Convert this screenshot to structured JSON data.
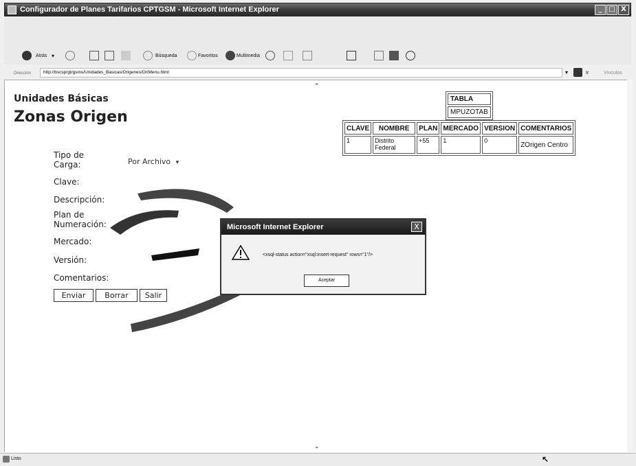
{
  "window": {
    "title": "Configurador de Planes Tarifarios CPTGSM - Microsoft Internet Explorer",
    "min": "_",
    "max": "□",
    "close": "X"
  },
  "toolbar": {
    "back": "Atrás",
    "search": "Búsqueda",
    "favorites": "Favoritos",
    "multimedia": "Multimedia",
    "go": "Ir"
  },
  "address": {
    "label": "Dirección",
    "url": "http://bscsprgt/gsms/Unidades_Basicas/Origenes/OriMenu.html",
    "links": "Vínculos"
  },
  "page": {
    "heading_small": "Unidades Básicas",
    "heading_large": "Zonas Origen"
  },
  "form": {
    "tipo_label": "Tipo de Carga:",
    "tipo_value": "Por Archivo",
    "clave_label": "Clave:",
    "descripcion_label": "Descripción:",
    "plan_label": "Plan de Numeración:",
    "mercado_label": "Mercado:",
    "version_label": "Versión:",
    "comentarios_label": "Comentarios:",
    "enviar": "Enviar",
    "borrar": "Borrar",
    "salir": "Salir"
  },
  "table_info": {
    "header": "TABLA",
    "name": "MPUZOTAB"
  },
  "data_table": {
    "columns": [
      "CLAVE",
      "NOMBRE",
      "PLAN",
      "MERCADO",
      "VERSION",
      "COMENTARIOS"
    ],
    "rows": [
      [
        "1",
        "Distrito Federal",
        "+55",
        "1",
        "0",
        "ZOrigen Centro"
      ]
    ]
  },
  "dialog": {
    "title": "Microsoft Internet Explorer",
    "message": "<xsql-status action=\"xsql:insert-request\" rows=\"1\"/>",
    "ok": "Aceptar",
    "close": "X"
  },
  "status": {
    "text": "Listo"
  }
}
